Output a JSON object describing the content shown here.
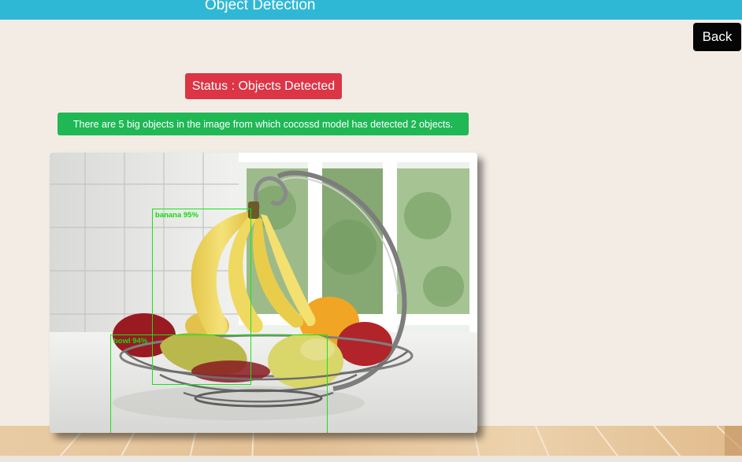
{
  "header": {
    "title": "Object Detection"
  },
  "back_button": {
    "label": "Back"
  },
  "status": {
    "text": "Status : Objects Detected"
  },
  "info": {
    "text": "There are 5 big objects in the image from which cocossd model has detected 2 objects."
  },
  "image": {
    "icon": "fruit-basket-photo"
  },
  "detections": [
    {
      "label": "banana 95%"
    },
    {
      "label": "bowl 94%"
    }
  ],
  "colors": {
    "header": "#2fb8d6",
    "status": "#dc3545",
    "info": "#1fb855",
    "detection_box": "#14e514",
    "background": "#f3ece5"
  }
}
